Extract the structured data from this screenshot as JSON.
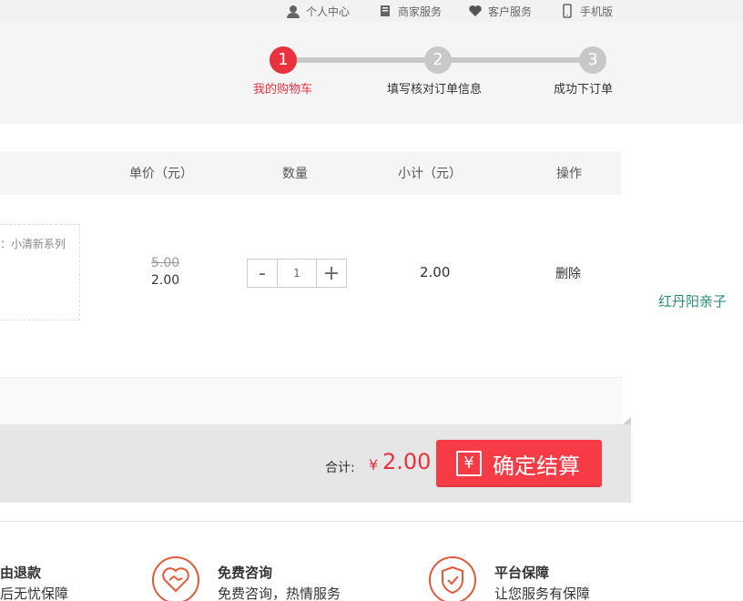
{
  "topbar": {
    "links": [
      {
        "label": "个人中心",
        "icon": "user-icon"
      },
      {
        "label": "商家服务",
        "icon": "store-icon"
      },
      {
        "label": "客户服务",
        "icon": "heart-icon"
      },
      {
        "label": "手机版",
        "icon": "mobile-icon"
      }
    ]
  },
  "steps": [
    {
      "number": "1",
      "label": "我的购物车",
      "active": true
    },
    {
      "number": "2",
      "label": "填写核对订单信息",
      "active": false
    },
    {
      "number": "3",
      "label": "成功下订单",
      "active": false
    }
  ],
  "table": {
    "headers": {
      "price": "单价（元）",
      "quantity": "数量",
      "subtotal": "小计（元）",
      "action": "操作"
    }
  },
  "item": {
    "spec": "：小清新系列",
    "original_price": "5.00",
    "price": "2.00",
    "quantity": "1",
    "subtotal": "2.00",
    "delete_label": "删除",
    "qty_minus": "-",
    "qty_plus": "+"
  },
  "side_link": "红丹阳亲子",
  "checkout": {
    "total_label": "合计:",
    "currency": "¥",
    "total": "2.00",
    "button_icon": "¥",
    "button_label": "确定结算"
  },
  "services": [
    {
      "title": "理由退款",
      "desc": "售后无忧保障",
      "icon": "refund-icon"
    },
    {
      "title": "免费咨询",
      "desc": "免费咨询，热情服务",
      "icon": "handshake-icon"
    },
    {
      "title": "平台保障",
      "desc": "让您服务有保障",
      "icon": "shield-icon"
    }
  ],
  "colors": {
    "accent": "#e8323f",
    "button": "#f63b46",
    "service_icon": "#e05b3a",
    "link_green": "#2e8b7b"
  }
}
